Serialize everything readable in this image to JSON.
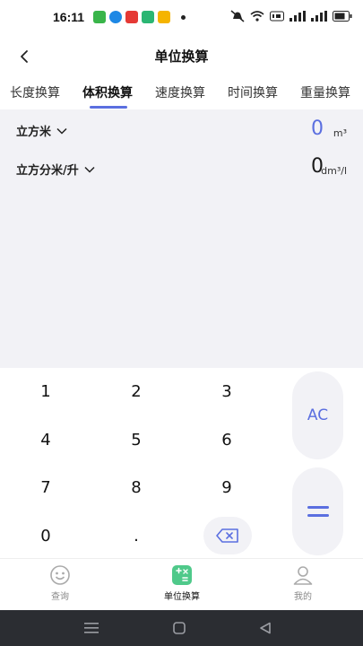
{
  "status": {
    "time": "16:11",
    "colors": {
      "wechat": "#39b54a",
      "blue": "#1e88e5",
      "red": "#e53935",
      "green": "#2bb673",
      "yellow": "#f5b400"
    }
  },
  "header": {
    "title": "单位换算",
    "back_icon": "chevron-left-icon"
  },
  "tabs": [
    {
      "label": "长度换算",
      "active": false
    },
    {
      "label": "体积换算",
      "active": true
    },
    {
      "label": "速度换算",
      "active": false
    },
    {
      "label": "时间换算",
      "active": false
    },
    {
      "label": "重量换算",
      "active": false
    }
  ],
  "conversion": {
    "source": {
      "unit": "立方米",
      "value": "0",
      "suffix": "m³",
      "value_color": "#5b6fe0"
    },
    "target": {
      "unit": "立方分米/升",
      "value": "0",
      "suffix": "dm³/l",
      "value_color": "#1a1a1a"
    }
  },
  "keypad": {
    "keys": [
      "1",
      "2",
      "3",
      "4",
      "5",
      "6",
      "7",
      "8",
      "9",
      "0",
      "."
    ],
    "clear_label": "AC",
    "equals_icon": "equals-icon",
    "delete_icon": "backspace-icon",
    "accent": "#5b6fe0"
  },
  "bottom_nav": [
    {
      "label": "查询",
      "icon": "smiley-icon",
      "active": false
    },
    {
      "label": "单位换算",
      "icon": "calculator-icon",
      "active": true
    },
    {
      "label": "我的",
      "icon": "user-icon",
      "active": false
    }
  ]
}
